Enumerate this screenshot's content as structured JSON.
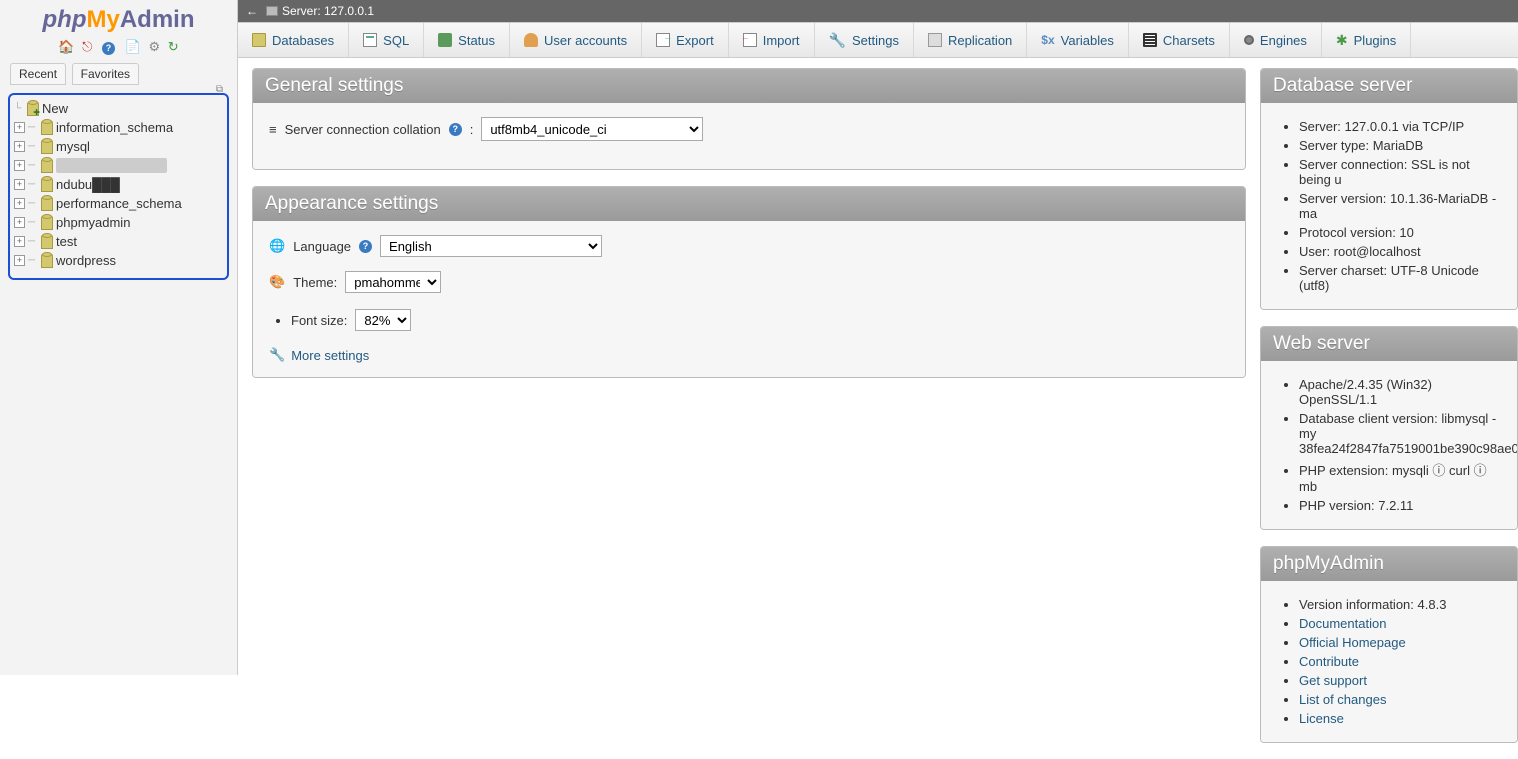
{
  "logo": {
    "php": "php",
    "my": "My",
    "admin": "Admin"
  },
  "sidebar_tabs": {
    "recent": "Recent",
    "favorites": "Favorites"
  },
  "databases": [
    {
      "name": "New",
      "new": true
    },
    {
      "name": "information_schema"
    },
    {
      "name": "mysql"
    },
    {
      "name": "████████████",
      "redacted": true
    },
    {
      "name": "ndubu███",
      "partial_redact": true
    },
    {
      "name": "performance_schema"
    },
    {
      "name": "phpmyadmin"
    },
    {
      "name": "test"
    },
    {
      "name": "wordpress"
    }
  ],
  "breadcrumb": {
    "server_label": "Server: 127.0.0.1"
  },
  "topnav": {
    "databases": "Databases",
    "sql": "SQL",
    "status": "Status",
    "user_accounts": "User accounts",
    "export": "Export",
    "import": "Import",
    "settings": "Settings",
    "replication": "Replication",
    "variables": "Variables",
    "charsets": "Charsets",
    "engines": "Engines",
    "plugins": "Plugins"
  },
  "general": {
    "heading": "General settings",
    "collation_label": "Server connection collation",
    "collation_value": "utf8mb4_unicode_ci"
  },
  "appearance": {
    "heading": "Appearance settings",
    "language_label": "Language",
    "language_value": "English",
    "theme_label": "Theme:",
    "theme_value": "pmahomme",
    "font_label": "Font size:",
    "font_value": "82%",
    "more_settings": "More settings"
  },
  "db_server": {
    "heading": "Database server",
    "items": [
      "Server: 127.0.0.1 via TCP/IP",
      "Server type: MariaDB",
      "Server connection: SSL is not being u",
      "Server version: 10.1.36-MariaDB - ma",
      "Protocol version: 10",
      "User: root@localhost",
      "Server charset: UTF-8 Unicode (utf8)"
    ]
  },
  "web_server": {
    "heading": "Web server",
    "items": [
      "Apache/2.4.35 (Win32) OpenSSL/1.1",
      "Database client version: libmysql - my 38fea24f2847fa7519001be390c98ae0",
      "PHP extension: mysqli ⓘ curl ⓘ mb",
      "PHP version: 7.2.11"
    ]
  },
  "pma": {
    "heading": "phpMyAdmin",
    "version": "Version information: 4.8.3",
    "links": [
      "Documentation",
      "Official Homepage",
      "Contribute",
      "Get support",
      "List of changes",
      "License"
    ]
  }
}
